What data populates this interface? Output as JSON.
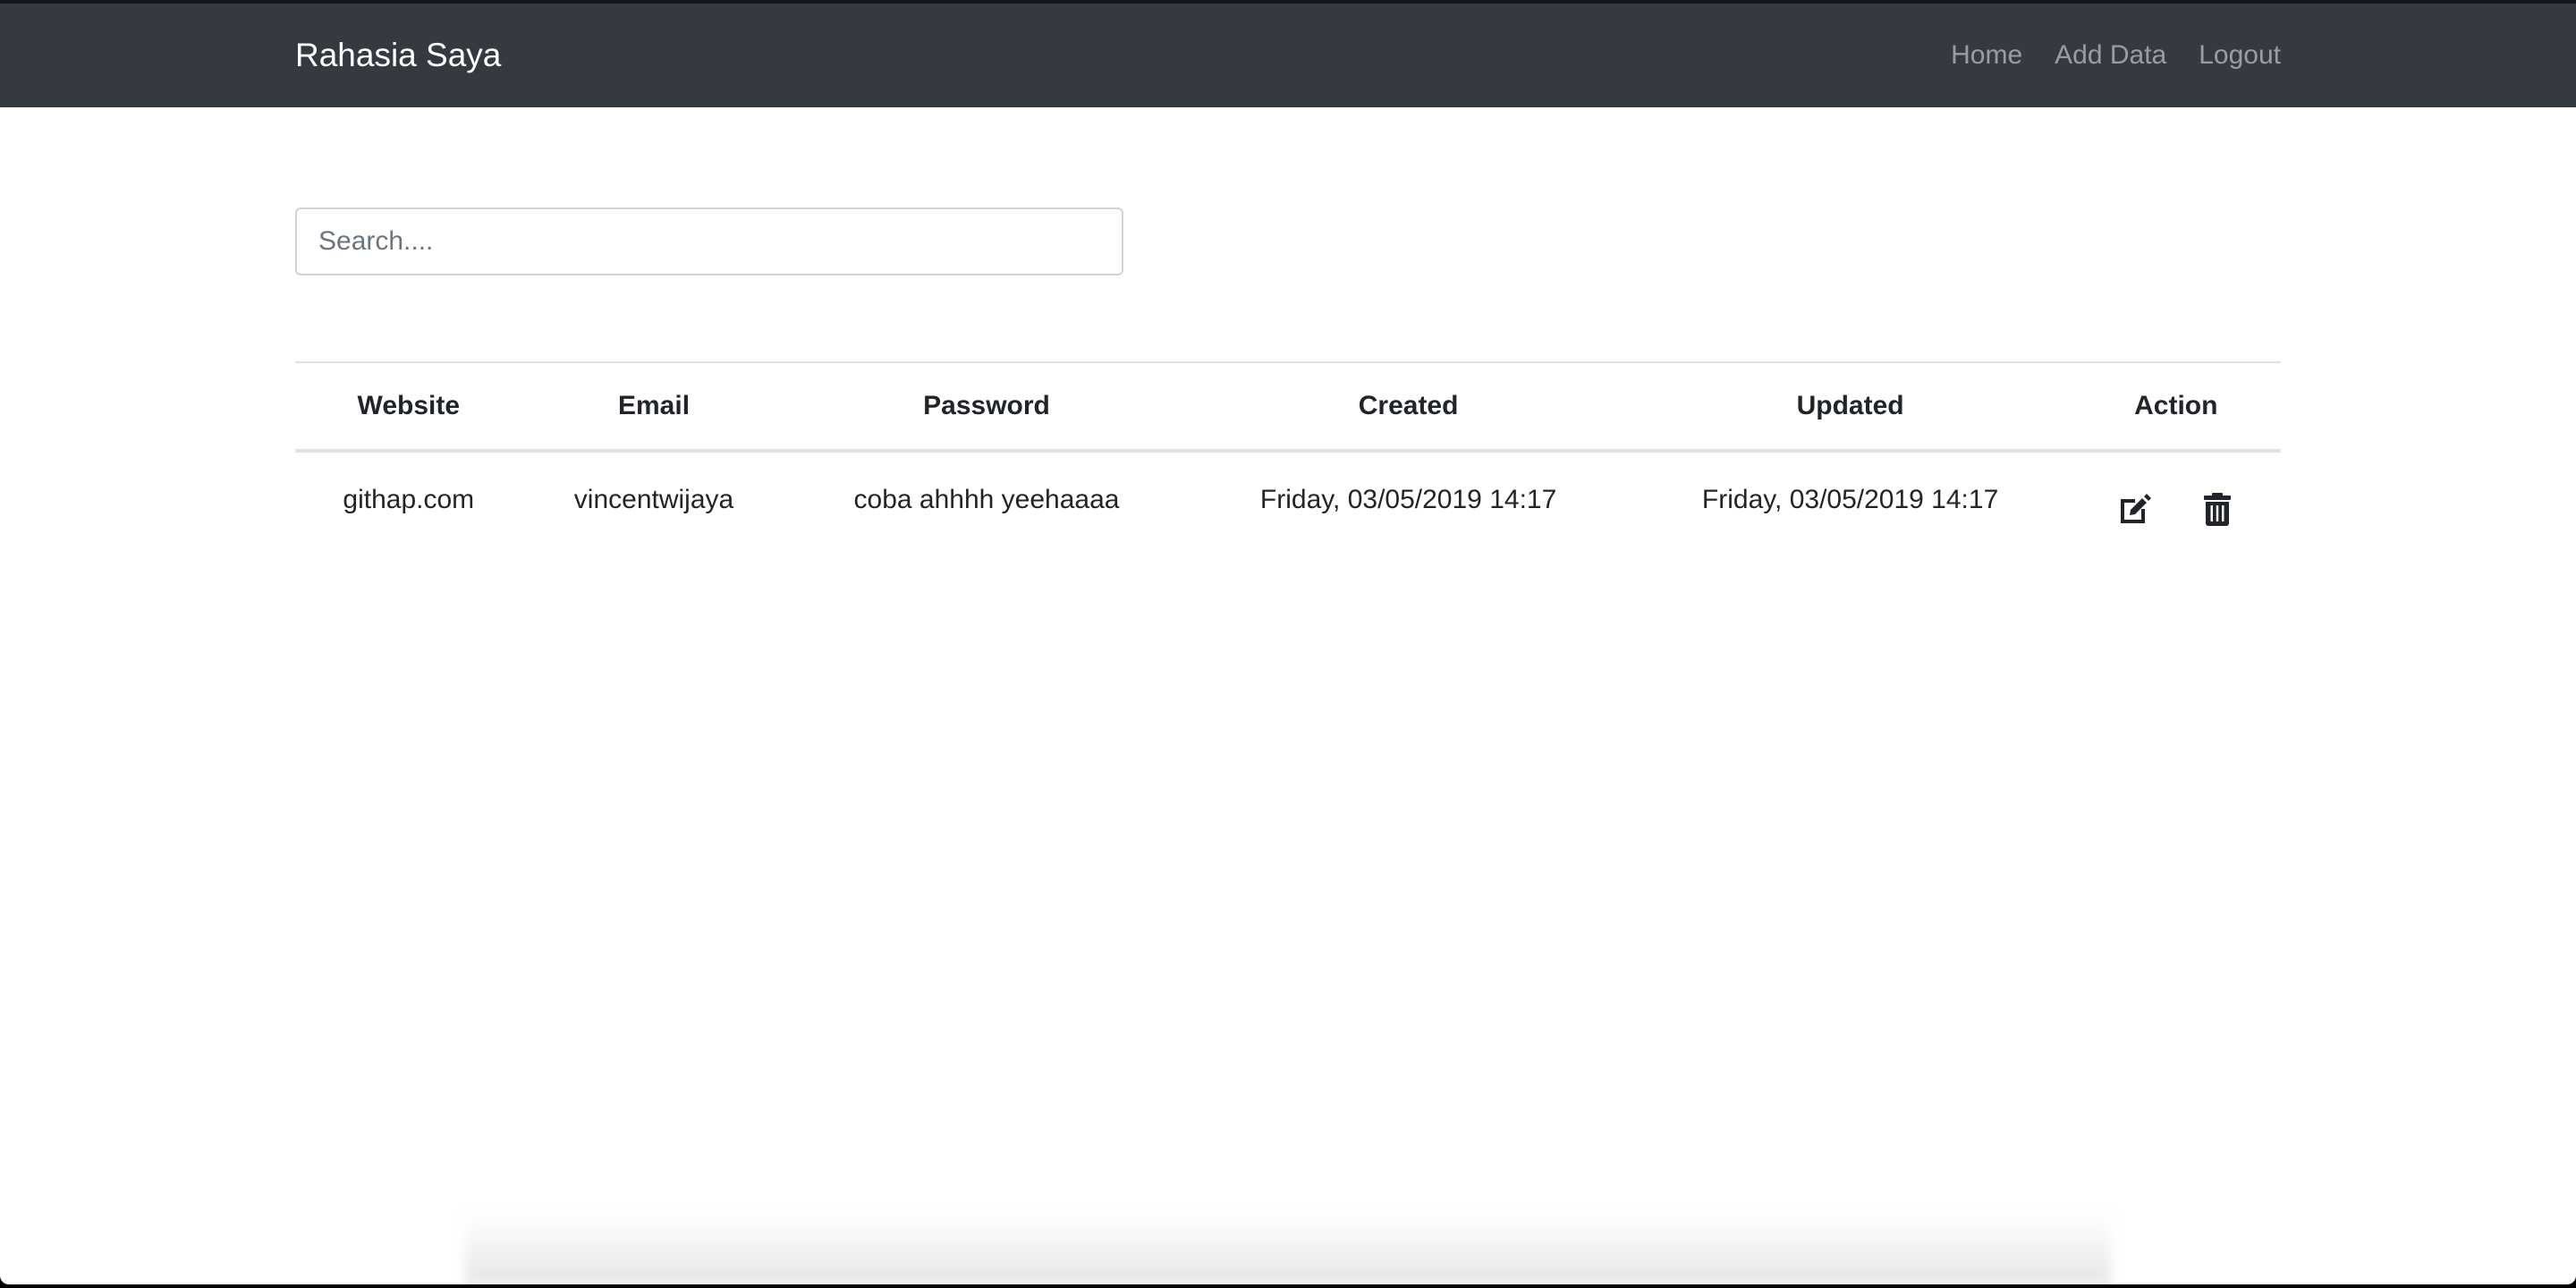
{
  "navbar": {
    "brand": "Rahasia Saya",
    "links": [
      {
        "label": "Home"
      },
      {
        "label": "Add Data"
      },
      {
        "label": "Logout"
      }
    ]
  },
  "search": {
    "placeholder": "Search....",
    "value": ""
  },
  "table": {
    "columns": [
      "Website",
      "Email",
      "Password",
      "Created",
      "Updated",
      "Action"
    ],
    "rows": [
      {
        "website": "githap.com",
        "email": "vincentwijaya",
        "password": "coba ahhhh yeehaaaa",
        "created": "Friday, 03/05/2019 14:17",
        "updated": "Friday, 03/05/2019 14:17",
        "actions": [
          "edit-icon",
          "trash-icon"
        ]
      }
    ]
  }
}
